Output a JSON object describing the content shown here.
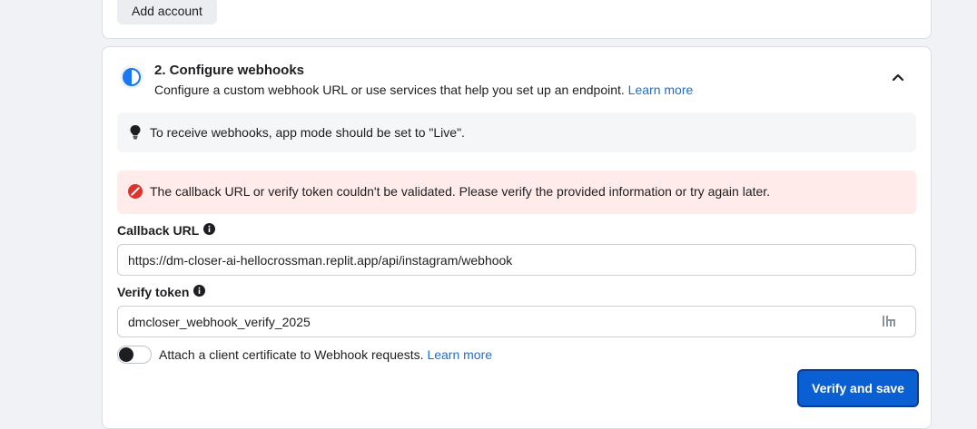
{
  "accounts": {
    "add_account_label": "Add account"
  },
  "webhooks_section": {
    "title": "2. Configure webhooks",
    "description": "Configure a custom webhook URL or use services that help you set up an endpoint.",
    "learn_more_label": "Learn more",
    "status_icon": "half-circle-icon",
    "collapse_icon": "chevron-up-icon",
    "info_notice": "To receive webhooks, app mode should be set to \"Live\".",
    "info_icon": "lightbulb-icon",
    "error_message": "The callback URL or verify token couldn't be validated. Please verify the provided information or try again later.",
    "error_icon": "error-icon",
    "callback_url": {
      "label": "Callback URL",
      "value": "https://dm-closer-ai-hellocrossman.replit.app/api/instagram/webhook"
    },
    "verify_token": {
      "label": "Verify token",
      "value": "dmcloser_webhook_verify_2025"
    },
    "client_certificate": {
      "label": "Attach a client certificate to Webhook requests.",
      "learn_more_label": "Learn more",
      "enabled": false
    },
    "verify_button_label": "Verify and save"
  },
  "colors": {
    "accent": "#0a5fd3",
    "link": "#1a6ed8",
    "error_bg": "#ffebe9",
    "error_icon": "#e0312b",
    "info_bg": "#f5f6f7"
  }
}
